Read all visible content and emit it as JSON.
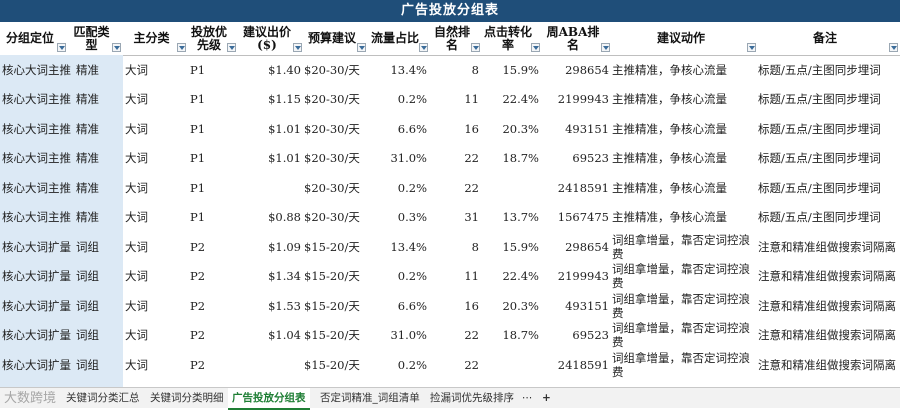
{
  "title": "广告投放分组表",
  "headers": [
    "分组定位",
    "匹配类型",
    "主分类",
    "投放优先级",
    "建议出价($)",
    "预算建议",
    "流量占比",
    "自然排名",
    "点击转化率",
    "周ABA排名",
    "建议动作",
    "备注"
  ],
  "header_display": [
    "分组定位",
    "匹配类\n型",
    "主分类",
    "投放优\n先级",
    "建议出价\n($)",
    "预算建议",
    "流量占比",
    "自然排名",
    "点击转化\n率",
    "周ABA排名",
    "建议动作",
    "备注"
  ],
  "rows": [
    [
      "核心大词主推",
      "精准",
      "大词",
      "P1",
      "$1.40",
      "$20-30/天",
      "13.4%",
      "8",
      "15.9%",
      "298654",
      "主推精准，争核心流量",
      "标题/五点/主图同步埋词"
    ],
    [
      "核心大词主推",
      "精准",
      "大词",
      "P1",
      "$1.15",
      "$20-30/天",
      "0.2%",
      "11",
      "22.4%",
      "2199943",
      "主推精准，争核心流量",
      "标题/五点/主图同步埋词"
    ],
    [
      "核心大词主推",
      "精准",
      "大词",
      "P1",
      "$1.01",
      "$20-30/天",
      "6.6%",
      "16",
      "20.3%",
      "493151",
      "主推精准，争核心流量",
      "标题/五点/主图同步埋词"
    ],
    [
      "核心大词主推",
      "精准",
      "大词",
      "P1",
      "$1.01",
      "$20-30/天",
      "31.0%",
      "22",
      "18.7%",
      "69523",
      "主推精准，争核心流量",
      "标题/五点/主图同步埋词"
    ],
    [
      "核心大词主推",
      "精准",
      "大词",
      "P1",
      "",
      "$20-30/天",
      "0.2%",
      "22",
      "",
      "2418591",
      "主推精准，争核心流量",
      "标题/五点/主图同步埋词"
    ],
    [
      "核心大词主推",
      "精准",
      "大词",
      "P1",
      "$0.88",
      "$20-30/天",
      "0.3%",
      "31",
      "13.7%",
      "1567475",
      "主推精准，争核心流量",
      "标题/五点/主图同步埋词"
    ],
    [
      "核心大词扩量",
      "词组",
      "大词",
      "P2",
      "$1.09",
      "$15-20/天",
      "13.4%",
      "8",
      "15.9%",
      "298654",
      "词组拿增量，靠否定词控浪费",
      "注意和精准组做搜索词隔离"
    ],
    [
      "核心大词扩量",
      "词组",
      "大词",
      "P2",
      "$1.34",
      "$15-20/天",
      "0.2%",
      "11",
      "22.4%",
      "2199943",
      "词组拿增量，靠否定词控浪费",
      "注意和精准组做搜索词隔离"
    ],
    [
      "核心大词扩量",
      "词组",
      "大词",
      "P2",
      "$1.53",
      "$15-20/天",
      "6.6%",
      "16",
      "20.3%",
      "493151",
      "词组拿增量，靠否定词控浪费",
      "注意和精准组做搜索词隔离"
    ],
    [
      "核心大词扩量",
      "词组",
      "大词",
      "P2",
      "$1.04",
      "$15-20/天",
      "31.0%",
      "22",
      "18.7%",
      "69523",
      "词组拿增量，靠否定词控浪费",
      "注意和精准组做搜索词隔离"
    ],
    [
      "核心大词扩量",
      "词组",
      "大词",
      "P2",
      "",
      "$15-20/天",
      "0.2%",
      "22",
      "",
      "2418591",
      "词组拿增量，靠否定词控浪费",
      "注意和精准组做搜索词隔离"
    ]
  ],
  "sheet_tabs": [
    "关键词分类汇总",
    "关键词分类明细",
    "广告投放分组表",
    "否定词精准_词组清单",
    "捡漏词优先级排序"
  ],
  "active_tab": "广告投放分组表",
  "sheet_more": "⋯",
  "sheet_add": "+",
  "watermark": "大数跨境"
}
